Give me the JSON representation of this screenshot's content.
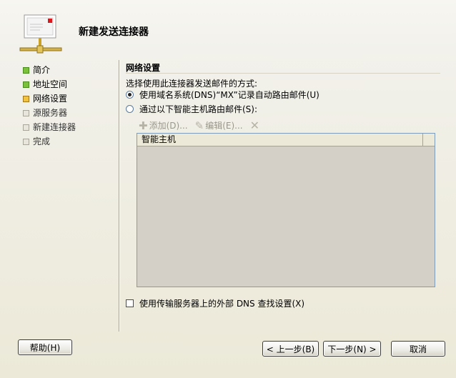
{
  "header": {
    "title": "新建发送连接器",
    "icon": "envelope-network-icon"
  },
  "steps": [
    {
      "label": "简介",
      "state": "done"
    },
    {
      "label": "地址空间",
      "state": "done"
    },
    {
      "label": "网络设置",
      "state": "current"
    },
    {
      "label": "源服务器",
      "state": "pending"
    },
    {
      "label": "新建连接器",
      "state": "pending"
    },
    {
      "label": "完成",
      "state": "pending"
    }
  ],
  "content": {
    "section_title": "网络设置",
    "prompt": "选择使用此连接器发送邮件的方式:",
    "radio_dns": {
      "label": "使用域名系统(DNS)“MX”记录自动路由邮件(U)",
      "checked": true
    },
    "radio_smarthost": {
      "label": "通过以下智能主机路由邮件(S):",
      "checked": false
    },
    "toolbar": {
      "add_label": "添加(D)...",
      "edit_label": "编辑(E)..."
    },
    "grid": {
      "column_header": "智能主机"
    },
    "checkbox_dns": {
      "label": "使用传输服务器上的外部 DNS 查找设置(X)",
      "checked": false
    }
  },
  "buttons": {
    "help": "帮助(H)",
    "back": "< 上一步(B)",
    "next": "下一步(N) >",
    "cancel": "取消"
  },
  "colors": {
    "done": "#7CC238",
    "current": "#F2C23C",
    "pending": "#E8E6DC"
  }
}
